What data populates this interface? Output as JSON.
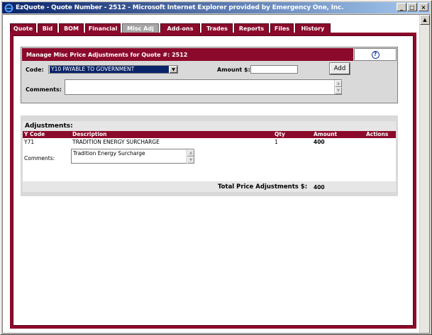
{
  "window": {
    "title": "EzQuote - Quote Number - 2512 - Microsoft Internet Explorer provided by Emergency One, Inc.",
    "minimize": "_",
    "maximize": "□",
    "close": "×"
  },
  "tabs": [
    {
      "label": "Quote",
      "active": false
    },
    {
      "label": "Bid",
      "active": false
    },
    {
      "label": "BOM",
      "active": false
    },
    {
      "label": "Financial",
      "active": false
    },
    {
      "label": "Misc Adj",
      "active": true
    },
    {
      "label": "Add-ons",
      "active": false
    },
    {
      "label": "Trades",
      "active": false
    },
    {
      "label": "Reports",
      "active": false
    },
    {
      "label": "Files",
      "active": false
    },
    {
      "label": "History",
      "active": false
    }
  ],
  "manage": {
    "header": "Manage Misc Price Adjustments for Quote #: 2512",
    "help": "?",
    "code_label": "Code:",
    "code_value": "Y10 PAYABLE TO GOVERNMENT",
    "amount_label": "Amount $:",
    "amount_value": "",
    "add_label": "Add",
    "comments_label": "Comments:",
    "comments_value": ""
  },
  "adjustments": {
    "title": "Adjustments:",
    "columns": {
      "ycode": "Y Code",
      "description": "Description",
      "qty": "Qty",
      "amount": "Amount",
      "actions": "Actions"
    },
    "rows": [
      {
        "ycode": "Y71",
        "description": "TRADITION ENERGY SURCHARGE",
        "qty": "1",
        "amount": "400",
        "comments_label": "Comments:",
        "comments": "Tradition Energy Surcharge"
      }
    ],
    "total_label": "Total Price Adjustments $:",
    "total_value": "400"
  },
  "colors": {
    "maroon": "#8b0a2b",
    "titlebar": "#0a246a"
  }
}
